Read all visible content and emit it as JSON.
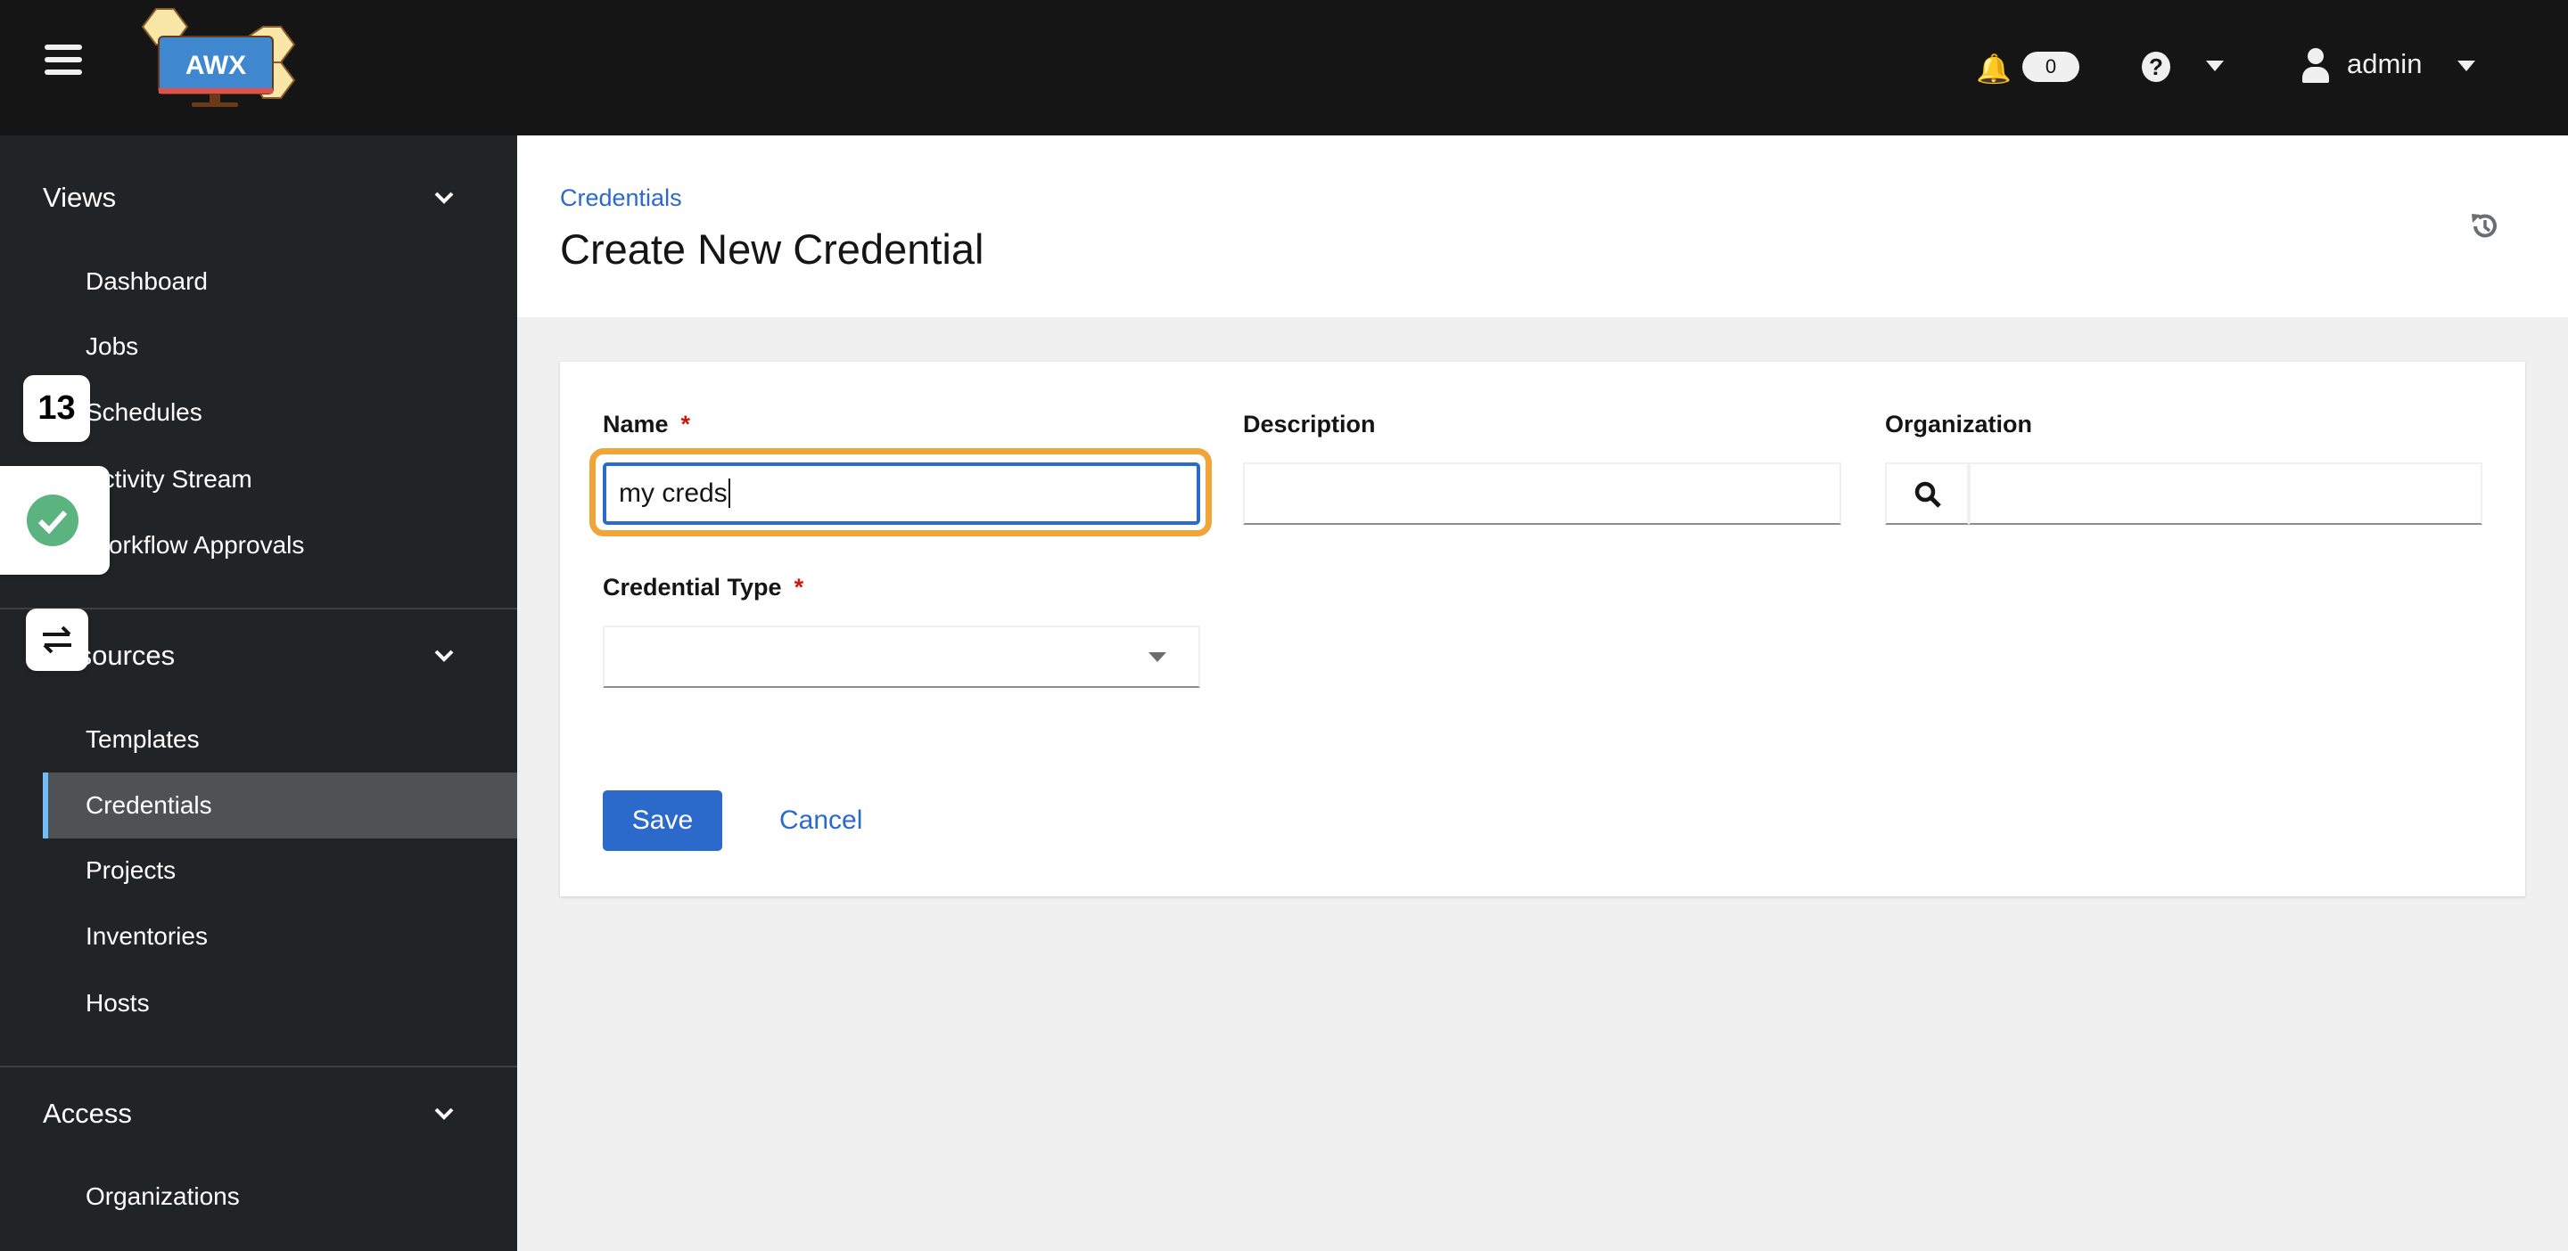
{
  "app": {
    "logo_text": "AWX"
  },
  "topbar": {
    "notification_count": "0",
    "username": "admin"
  },
  "sidebar": {
    "sections": [
      {
        "label": "Views",
        "items": [
          "Dashboard",
          "Jobs",
          "Schedules",
          "Activity Stream",
          "Workflow Approvals"
        ]
      },
      {
        "label": "Resources",
        "items": [
          "Templates",
          "Credentials",
          "Projects",
          "Inventories",
          "Hosts"
        ]
      },
      {
        "label": "Access",
        "items": [
          "Organizations"
        ]
      }
    ],
    "selected": "Credentials"
  },
  "overlays": {
    "counter": "13"
  },
  "page": {
    "breadcrumb": "Credentials",
    "title": "Create New Credential"
  },
  "form": {
    "name": {
      "label": "Name",
      "required": "*",
      "value": "my creds"
    },
    "description": {
      "label": "Description",
      "value": ""
    },
    "organization": {
      "label": "Organization",
      "value": ""
    },
    "credential_type": {
      "label": "Credential Type",
      "required": "*",
      "value": ""
    },
    "save_label": "Save",
    "cancel_label": "Cancel"
  },
  "colors": {
    "primary": "#2b6acb",
    "focus_ring": "#f0a53b",
    "required": "#c9190b",
    "success": "#5bb37f"
  }
}
